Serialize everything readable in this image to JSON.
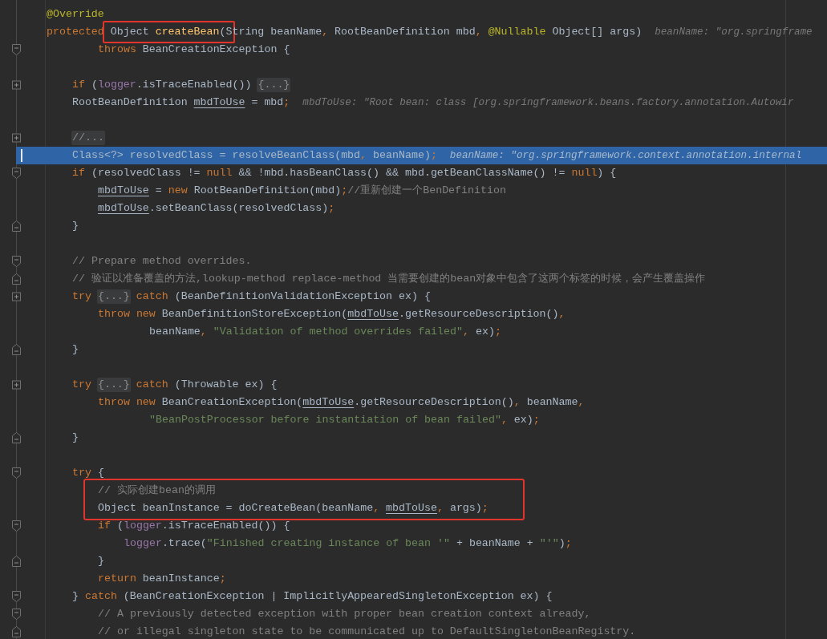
{
  "editor": {
    "lines": [
      {
        "kind": "line",
        "current": false,
        "parts": [
          {
            "kind": "code",
            "tokens": [
              {
                "kind": "annotation",
                "text": "@Override"
              }
            ]
          }
        ]
      },
      {
        "kind": "line",
        "current": false,
        "parts": [
          {
            "kind": "code",
            "tokens": [
              {
                "kind": "keyword",
                "text": "protected "
              }
            ]
          },
          {
            "kind": "frame",
            "tokens": [
              {
                "kind": "plain",
                "text": "Object "
              },
              {
                "kind": "method",
                "text": "createBean"
              },
              {
                "kind": "plain",
                "text": "(S"
              }
            ]
          },
          {
            "kind": "code",
            "tokens": [
              {
                "kind": "plain",
                "text": "tring beanName"
              },
              {
                "kind": "keyword",
                "text": ", "
              },
              {
                "kind": "plain",
                "text": "RootBeanDefinition mbd"
              },
              {
                "kind": "keyword",
                "text": ", "
              },
              {
                "kind": "annotation",
                "text": "@Nullable "
              },
              {
                "kind": "plain",
                "text": "Object[] args)"
              }
            ]
          },
          {
            "kind": "hint",
            "text": "beanName: \"org.springframe"
          }
        ],
        "children": [
          {
            "kind": "wrap",
            "current": false,
            "fold": {
              "kind": "start"
            },
            "parts": [
              {
                "kind": "code",
                "tokens": [
                  {
                    "kind": "keyword",
                    "text": "throws "
                  },
                  {
                    "kind": "plain",
                    "text": "BeanCreationException {"
                  }
                ]
              }
            ]
          },
          {
            "kind": "blank",
            "current": false
          },
          {
            "kind": "line",
            "current": false,
            "fold": {
              "kind": "collapsed"
            },
            "parts": [
              {
                "kind": "code",
                "tokens": [
                  {
                    "kind": "keyword",
                    "text": "if "
                  },
                  {
                    "kind": "plain",
                    "text": "("
                  },
                  {
                    "kind": "field",
                    "text": "logger"
                  },
                  {
                    "kind": "plain",
                    "text": ".isTraceEnabled()) "
                  }
                ]
              },
              {
                "kind": "folded",
                "text": "{...}"
              }
            ]
          },
          {
            "kind": "line",
            "current": false,
            "parts": [
              {
                "kind": "code",
                "tokens": [
                  {
                    "kind": "plain",
                    "text": "RootBeanDefinition "
                  },
                  {
                    "kind": "local",
                    "text": "mbdToUse"
                  },
                  {
                    "kind": "plain",
                    "text": " = mbd"
                  },
                  {
                    "kind": "keyword",
                    "text": ";"
                  }
                ]
              },
              {
                "kind": "hint",
                "text": "mbdToUse: \"Root bean: class [org.springframework.beans.factory.annotation.Autowir"
              }
            ]
          },
          {
            "kind": "blank",
            "current": false
          },
          {
            "kind": "line",
            "current": false,
            "fold": {
              "kind": "collapsed"
            },
            "parts": [
              {
                "kind": "folded",
                "text": "//..."
              }
            ]
          },
          {
            "kind": "line",
            "current": true,
            "parts": [
              {
                "kind": "code",
                "tokens": [
                  {
                    "kind": "plain",
                    "text": "Class<?> resolvedClass = resolveBeanClass(mbd"
                  },
                  {
                    "kind": "keyword",
                    "text": ", "
                  },
                  {
                    "kind": "plain",
                    "text": "beanName)"
                  },
                  {
                    "kind": "keyword",
                    "text": ";"
                  }
                ]
              },
              {
                "kind": "hint",
                "text": "beanName: \"org.springframework.context.annotation.internal"
              }
            ]
          },
          {
            "kind": "line",
            "current": false,
            "fold": {
              "kind": "start"
            },
            "parts": [
              {
                "kind": "code",
                "tokens": [
                  {
                    "kind": "keyword",
                    "text": "if "
                  },
                  {
                    "kind": "plain",
                    "text": "(resolvedClass != "
                  },
                  {
                    "kind": "keyword",
                    "text": "null "
                  },
                  {
                    "kind": "plain",
                    "text": "&& !mbd.hasBeanClass() && mbd.getBeanClassName() != "
                  },
                  {
                    "kind": "keyword",
                    "text": "null"
                  },
                  {
                    "kind": "plain",
                    "text": ") {"
                  }
                ]
              }
            ],
            "children": [
              {
                "kind": "line",
                "current": false,
                "parts": [
                  {
                    "kind": "code",
                    "tokens": [
                      {
                        "kind": "local",
                        "text": "mbdToUse"
                      },
                      {
                        "kind": "plain",
                        "text": " = "
                      },
                      {
                        "kind": "keyword",
                        "text": "new "
                      },
                      {
                        "kind": "plain",
                        "text": "RootBeanDefinition(mbd)"
                      },
                      {
                        "kind": "keyword",
                        "text": ";"
                      },
                      {
                        "kind": "comment",
                        "text": "//重新创建一个BenDefinition"
                      }
                    ]
                  }
                ]
              },
              {
                "kind": "line",
                "current": false,
                "parts": [
                  {
                    "kind": "code",
                    "tokens": [
                      {
                        "kind": "local",
                        "text": "mbdToUse"
                      },
                      {
                        "kind": "plain",
                        "text": ".setBeanClass(resolvedClass)"
                      },
                      {
                        "kind": "keyword",
                        "text": ";"
                      }
                    ]
                  }
                ]
              }
            ]
          },
          {
            "kind": "line",
            "current": false,
            "fold": {
              "kind": "end"
            },
            "parts": [
              {
                "kind": "code",
                "tokens": [
                  {
                    "kind": "plain",
                    "text": "}"
                  }
                ]
              }
            ]
          },
          {
            "kind": "blank",
            "current": false
          },
          {
            "kind": "line",
            "current": false,
            "fold": {
              "kind": "start"
            },
            "parts": [
              {
                "kind": "code",
                "tokens": [
                  {
                    "kind": "comment",
                    "text": "// Prepare method overrides."
                  }
                ]
              }
            ]
          },
          {
            "kind": "line",
            "current": false,
            "fold": {
              "kind": "end"
            },
            "parts": [
              {
                "kind": "code",
                "tokens": [
                  {
                    "kind": "comment",
                    "text": "// 验证以准备覆盖的方法,lookup-method replace-method 当需要创建的bean对象中包含了这两个标签的时候，会产生覆盖操作"
                  }
                ]
              }
            ]
          },
          {
            "kind": "line",
            "current": false,
            "fold": {
              "kind": "collapsed"
            },
            "parts": [
              {
                "kind": "code",
                "tokens": [
                  {
                    "kind": "keyword",
                    "text": "try "
                  }
                ]
              },
              {
                "kind": "folded",
                "text": "{...}"
              },
              {
                "kind": "code",
                "tokens": [
                  {
                    "kind": "keyword",
                    "text": " catch "
                  },
                  {
                    "kind": "plain",
                    "text": "(BeanDefinitionValidationException ex) {"
                  }
                ]
              }
            ],
            "children": [
              {
                "kind": "line",
                "current": false,
                "parts": [
                  {
                    "kind": "code",
                    "tokens": [
                      {
                        "kind": "keyword",
                        "text": "throw new "
                      },
                      {
                        "kind": "plain",
                        "text": "BeanDefinitionStoreException("
                      },
                      {
                        "kind": "local",
                        "text": "mbdToUse"
                      },
                      {
                        "kind": "plain",
                        "text": ".getResourceDescription()"
                      },
                      {
                        "kind": "keyword",
                        "text": ","
                      }
                    ]
                  }
                ],
                "children": [
                  {
                    "kind": "wrap",
                    "current": false,
                    "parts": [
                      {
                        "kind": "code",
                        "tokens": [
                          {
                            "kind": "plain",
                            "text": "beanName"
                          },
                          {
                            "kind": "keyword",
                            "text": ", "
                          },
                          {
                            "kind": "string",
                            "text": "\"Validation of method overrides failed\""
                          },
                          {
                            "kind": "keyword",
                            "text": ", "
                          },
                          {
                            "kind": "plain",
                            "text": "ex)"
                          },
                          {
                            "kind": "keyword",
                            "text": ";"
                          }
                        ]
                      }
                    ]
                  }
                ]
              }
            ]
          },
          {
            "kind": "line",
            "current": false,
            "fold": {
              "kind": "end"
            },
            "parts": [
              {
                "kind": "code",
                "tokens": [
                  {
                    "kind": "plain",
                    "text": "}"
                  }
                ]
              }
            ]
          },
          {
            "kind": "blank",
            "current": false
          },
          {
            "kind": "line",
            "current": false,
            "fold": {
              "kind": "collapsed"
            },
            "parts": [
              {
                "kind": "code",
                "tokens": [
                  {
                    "kind": "keyword",
                    "text": "try "
                  }
                ]
              },
              {
                "kind": "folded",
                "text": "{...}"
              },
              {
                "kind": "code",
                "tokens": [
                  {
                    "kind": "keyword",
                    "text": " catch "
                  },
                  {
                    "kind": "plain",
                    "text": "(Throwable ex) {"
                  }
                ]
              }
            ],
            "children": [
              {
                "kind": "line",
                "current": false,
                "parts": [
                  {
                    "kind": "code",
                    "tokens": [
                      {
                        "kind": "keyword",
                        "text": "throw new "
                      },
                      {
                        "kind": "plain",
                        "text": "BeanCreationException("
                      },
                      {
                        "kind": "local",
                        "text": "mbdToUse"
                      },
                      {
                        "kind": "plain",
                        "text": ".getResourceDescription()"
                      },
                      {
                        "kind": "keyword",
                        "text": ", "
                      },
                      {
                        "kind": "plain",
                        "text": "beanName"
                      },
                      {
                        "kind": "keyword",
                        "text": ","
                      }
                    ]
                  }
                ],
                "children": [
                  {
                    "kind": "wrap",
                    "current": false,
                    "parts": [
                      {
                        "kind": "code",
                        "tokens": [
                          {
                            "kind": "string",
                            "text": "\"BeanPostProcessor before instantiation of bean failed\""
                          },
                          {
                            "kind": "keyword",
                            "text": ", "
                          },
                          {
                            "kind": "plain",
                            "text": "ex)"
                          },
                          {
                            "kind": "keyword",
                            "text": ";"
                          }
                        ]
                      }
                    ]
                  }
                ]
              }
            ]
          },
          {
            "kind": "line",
            "current": false,
            "fold": {
              "kind": "end"
            },
            "parts": [
              {
                "kind": "code",
                "tokens": [
                  {
                    "kind": "plain",
                    "text": "}"
                  }
                ]
              }
            ]
          },
          {
            "kind": "blank",
            "current": false
          },
          {
            "kind": "line",
            "current": false,
            "fold": {
              "kind": "start"
            },
            "parts": [
              {
                "kind": "code",
                "tokens": [
                  {
                    "kind": "keyword",
                    "text": "try "
                  },
                  {
                    "kind": "plain",
                    "text": "{"
                  }
                ]
              }
            ],
            "children": [
              {
                "kind": "frame",
                "lines": [
                  {
                    "kind": "line",
                    "current": false,
                    "parts": [
                      {
                        "kind": "code",
                        "tokens": [
                          {
                            "kind": "comment",
                            "text": "// 实际创建bean的调用"
                          }
                        ]
                      }
                    ]
                  },
                  {
                    "kind": "line",
                    "current": false,
                    "parts": [
                      {
                        "kind": "code",
                        "tokens": [
                          {
                            "kind": "plain",
                            "text": "Object beanInstance = doCreateBean(beanName"
                          },
                          {
                            "kind": "keyword",
                            "text": ", "
                          },
                          {
                            "kind": "local",
                            "text": "mbdToUse"
                          },
                          {
                            "kind": "keyword",
                            "text": ", "
                          },
                          {
                            "kind": "plain",
                            "text": "args)"
                          },
                          {
                            "kind": "keyword",
                            "text": ";"
                          }
                        ]
                      }
                    ]
                  }
                ]
              },
              {
                "kind": "line",
                "current": false,
                "fold": {
                  "kind": "start"
                },
                "parts": [
                  {
                    "kind": "code",
                    "tokens": [
                      {
                        "kind": "keyword",
                        "text": "if "
                      },
                      {
                        "kind": "plain",
                        "text": "("
                      },
                      {
                        "kind": "field",
                        "text": "logger"
                      },
                      {
                        "kind": "plain",
                        "text": ".isTraceEnabled()) {"
                      }
                    ]
                  }
                ],
                "children": [
                  {
                    "kind": "line",
                    "current": false,
                    "parts": [
                      {
                        "kind": "code",
                        "tokens": [
                          {
                            "kind": "field",
                            "text": "logger"
                          },
                          {
                            "kind": "plain",
                            "text": ".trace("
                          },
                          {
                            "kind": "string",
                            "text": "\"Finished creating instance of bean '\" "
                          },
                          {
                            "kind": "plain",
                            "text": "+ beanName + "
                          },
                          {
                            "kind": "string",
                            "text": "\"'\""
                          },
                          {
                            "kind": "plain",
                            "text": ")"
                          },
                          {
                            "kind": "keyword",
                            "text": ";"
                          }
                        ]
                      }
                    ]
                  }
                ]
              },
              {
                "kind": "line",
                "current": false,
                "fold": {
                  "kind": "end"
                },
                "parts": [
                  {
                    "kind": "code",
                    "tokens": [
                      {
                        "kind": "plain",
                        "text": "}"
                      }
                    ]
                  }
                ]
              },
              {
                "kind": "line",
                "current": false,
                "parts": [
                  {
                    "kind": "code",
                    "tokens": [
                      {
                        "kind": "keyword",
                        "text": "return "
                      },
                      {
                        "kind": "plain",
                        "text": "beanInstance"
                      },
                      {
                        "kind": "keyword",
                        "text": ";"
                      }
                    ]
                  }
                ]
              }
            ]
          },
          {
            "kind": "line",
            "current": false,
            "fold": {
              "kind": "start"
            },
            "parts": [
              {
                "kind": "code",
                "tokens": [
                  {
                    "kind": "plain",
                    "text": "} "
                  },
                  {
                    "kind": "keyword",
                    "text": "catch "
                  },
                  {
                    "kind": "plain",
                    "text": "(BeanCreationException | ImplicitlyAppearedSingletonException ex) {"
                  }
                ]
              }
            ],
            "children": [
              {
                "kind": "line",
                "current": false,
                "fold": {
                  "kind": "start"
                },
                "parts": [
                  {
                    "kind": "code",
                    "tokens": [
                      {
                        "kind": "comment",
                        "text": "// A previously detected exception with proper bean creation context already,"
                      }
                    ]
                  }
                ]
              },
              {
                "kind": "line",
                "current": false,
                "fold": {
                  "kind": "end"
                },
                "parts": [
                  {
                    "kind": "code",
                    "tokens": [
                      {
                        "kind": "comment",
                        "text": "// or illegal singleton state to be communicated up to DefaultSingletonBeanRegistry."
                      }
                    ]
                  }
                ]
              }
            ]
          }
        ]
      }
    ]
  }
}
